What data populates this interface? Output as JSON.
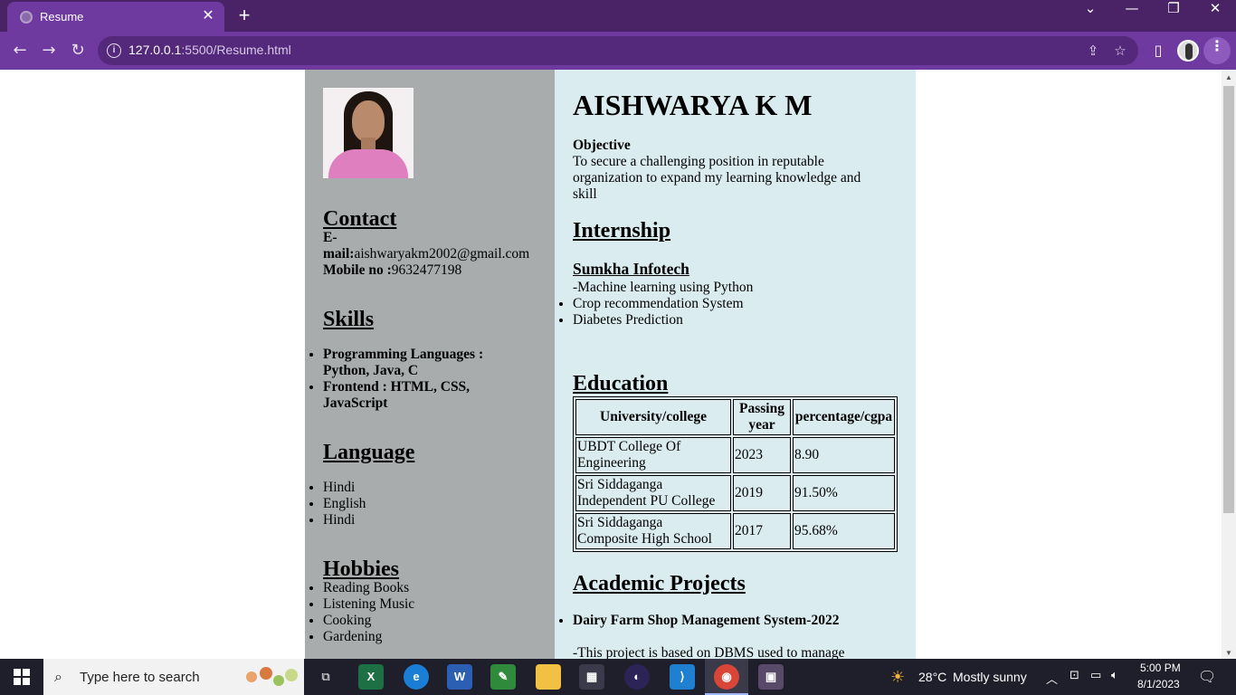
{
  "browser": {
    "tab_title": "Resume",
    "tab_close": "✕",
    "new_tab": "+",
    "url_host": "127.0.0.1",
    "url_rest": ":5500/Resume.html",
    "window_controls": {
      "tabsearch": "⌄",
      "minimize": "—",
      "restore": "❐",
      "close": "✕"
    }
  },
  "resume": {
    "name": "AISHWARYA K M",
    "photo_alt": "profile-photo",
    "contact": {
      "heading": "Contact",
      "email_label": "E-mail:",
      "email_label_line1": "E-",
      "email_label_line2": "mail:",
      "email": "aishwaryakm2002@gmail.com",
      "mobile_label": "Mobile no :",
      "mobile": "9632477198"
    },
    "skills": {
      "heading": "Skills",
      "items": [
        {
          "line1": "Programming Languages :",
          "line2": "Python, Java, C"
        },
        {
          "line1": "Frontend : HTML, CSS,",
          "line2": "JavaScript"
        }
      ]
    },
    "language": {
      "heading": "Language",
      "items": [
        "Hindi",
        "English",
        "Hindi"
      ]
    },
    "hobbies": {
      "heading": "Hobbies",
      "items": [
        "Reading Books",
        "Listening Music",
        "Cooking",
        "Gardening"
      ]
    },
    "objective": {
      "heading": "Objective",
      "lines": [
        "To secure a challenging position in reputable",
        "organization to expand my learning knowledge and",
        "skill"
      ]
    },
    "internship": {
      "heading": "Internship",
      "company": "Sumkha Infotech",
      "subtitle": "-Machine learning using Python",
      "items": [
        "Crop recommendation System",
        "Diabetes Prediction"
      ]
    },
    "education": {
      "heading": "Education",
      "columns": [
        "University/college",
        "Passing year",
        "percentage/cgpa"
      ],
      "col2_lines": [
        "Passing",
        "year"
      ],
      "rows": [
        {
          "college_l1": "UBDT College Of",
          "college_l2": "Engineering",
          "year": "2023",
          "score": "8.90"
        },
        {
          "college_l1": "Sri Siddaganga",
          "college_l2": "Independent PU College",
          "year": "2019",
          "score": "91.50%"
        },
        {
          "college_l1": "Sri Siddaganga",
          "college_l2": "Composite High School",
          "year": "2017",
          "score": "95.68%"
        }
      ]
    },
    "projects": {
      "heading": "Academic Projects",
      "items": [
        "Dairy Farm Shop Management System-2022"
      ],
      "description": "-This project is based on DBMS used to manage"
    }
  },
  "taskbar": {
    "search_placeholder": "Type here to search",
    "weather_temp": "28°C",
    "weather_text": "Mostly sunny",
    "time": "5:00 PM",
    "date": "8/1/2023",
    "apps": [
      "task-view",
      "excel",
      "edge",
      "word",
      "notepad",
      "file-explorer",
      "store",
      "eclipse",
      "vscode",
      "chrome",
      "photo-app"
    ]
  }
}
